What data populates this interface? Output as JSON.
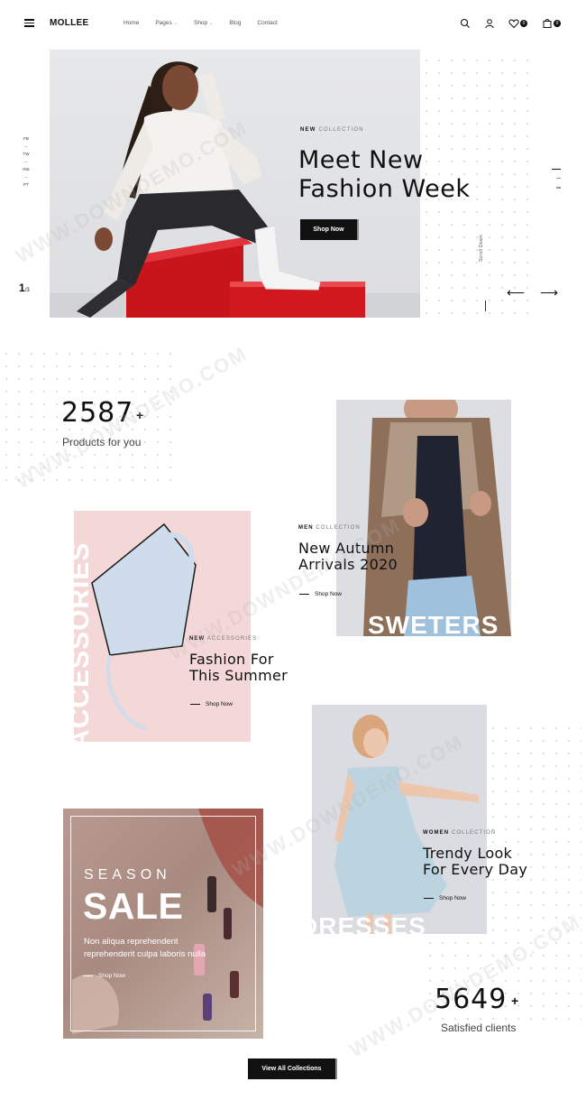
{
  "header": {
    "logo": "MOLLEE",
    "nav": [
      {
        "label": "Home",
        "dropdown": false
      },
      {
        "label": "Pages",
        "dropdown": true
      },
      {
        "label": "Shop",
        "dropdown": true
      },
      {
        "label": "Blog",
        "dropdown": false
      },
      {
        "label": "Contact",
        "dropdown": false
      }
    ],
    "wishlist_count": "0",
    "cart_count": "0"
  },
  "hero": {
    "social": [
      "FB",
      "TW",
      "INS",
      "PT"
    ],
    "slide_current": "1",
    "slide_total": "/3",
    "tag_bold": "NEW",
    "tag_rest": " COLLECTION",
    "title_line1": "Meet New",
    "title_line2": "Fashion Week",
    "button": "Shop Now",
    "scroll_label": "Scroll Down",
    "prev_arrow": "⟵",
    "next_arrow": "⟶"
  },
  "stats": {
    "products_count": "2587",
    "products_plus": "+",
    "products_label": "Products for you",
    "clients_count": "5649",
    "clients_plus": "+",
    "clients_label": "Satisfied clients"
  },
  "collections": {
    "men": {
      "tag_bold": "MEN",
      "tag_rest": " COLLECTION",
      "title_line1": "New Autumn",
      "title_line2": "Arrivals 2020",
      "link": "Shop Now",
      "big_word": "SWETERS"
    },
    "accessories": {
      "tag_bold": "NEW",
      "tag_rest": " ACCESSORIES",
      "title_line1": "Fashion For",
      "title_line2": "This Summer",
      "link": "Shop Now",
      "big_word": "ACCESSORIES"
    },
    "women": {
      "tag_bold": "WOMEN",
      "tag_rest": " COLLECTION",
      "title_line1": "Trendy Look",
      "title_line2": "For Every Day",
      "link": "Shop Now",
      "big_word": "DRESSES"
    },
    "sale": {
      "season": "SEASON",
      "sale": "SALE",
      "desc": "Non aliqua reprehenderit reprehenderit culpa laboris nulla",
      "link": "Shop Now"
    }
  },
  "view_all": "View All Collections",
  "watermark": "WWW.DOWNDEMO.COM",
  "colors": {
    "primary": "#111111",
    "accent_pink": "#f5d7d7",
    "hero_bg": "#e2e3e6",
    "sale_bg": "#b08f86"
  }
}
